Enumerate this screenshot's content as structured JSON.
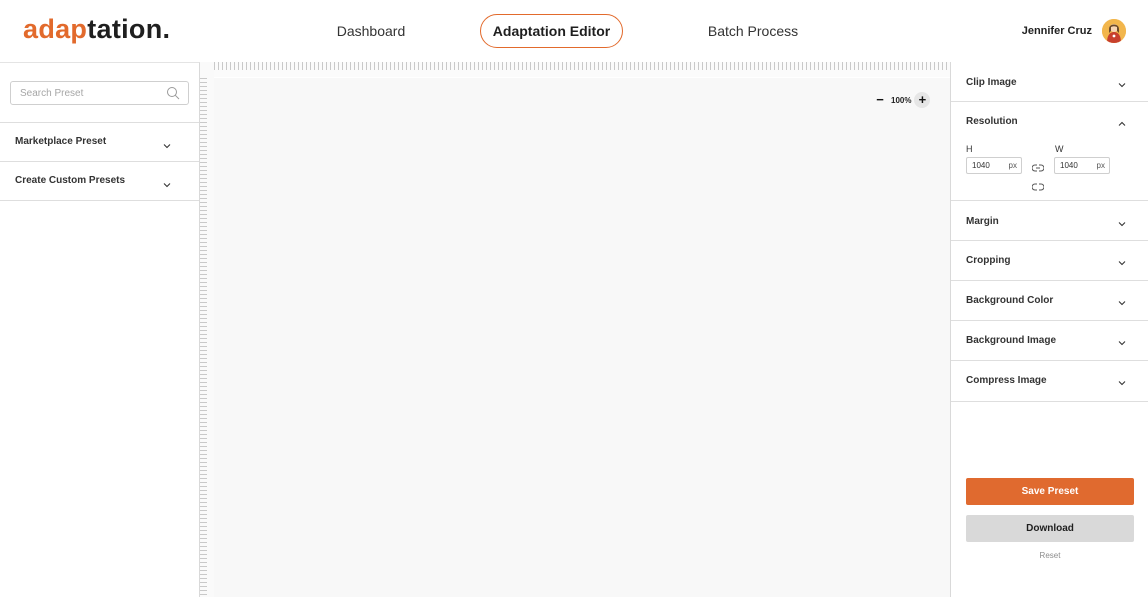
{
  "header": {
    "logo_accent": "adap",
    "logo_rest": "tation.",
    "tabs": [
      {
        "label": "Dashboard"
      },
      {
        "label": "Adaptation Editor"
      },
      {
        "label": "Batch Process"
      }
    ],
    "active_tab": "Adaptation Editor",
    "user_name": "Jennifer Cruz",
    "avatar_icon": "user-avatar"
  },
  "left_panel": {
    "search_placeholder": "Search Preset",
    "sections": [
      {
        "label": "Marketplace Preset"
      },
      {
        "label": "Create Custom Presets"
      }
    ]
  },
  "canvas": {
    "zoom_level": "100%",
    "zoom_out": "−",
    "zoom_in": "+"
  },
  "right_panel": {
    "sections": [
      {
        "label": "Clip Image"
      },
      {
        "label": "Resolution"
      },
      {
        "label": "Margin"
      },
      {
        "label": "Cropping"
      },
      {
        "label": "Background Color"
      },
      {
        "label": "Background Image"
      },
      {
        "label": "Compress Image"
      }
    ],
    "resolution": {
      "h_label": "H",
      "w_label": "W",
      "h_value": "1040",
      "w_value": "1040",
      "unit": "px"
    },
    "save_label": "Save Preset",
    "download_label": "Download",
    "reset_label": "Reset"
  },
  "colors": {
    "accent": "#e26a2c",
    "download_bg": "#d9d9d9"
  }
}
